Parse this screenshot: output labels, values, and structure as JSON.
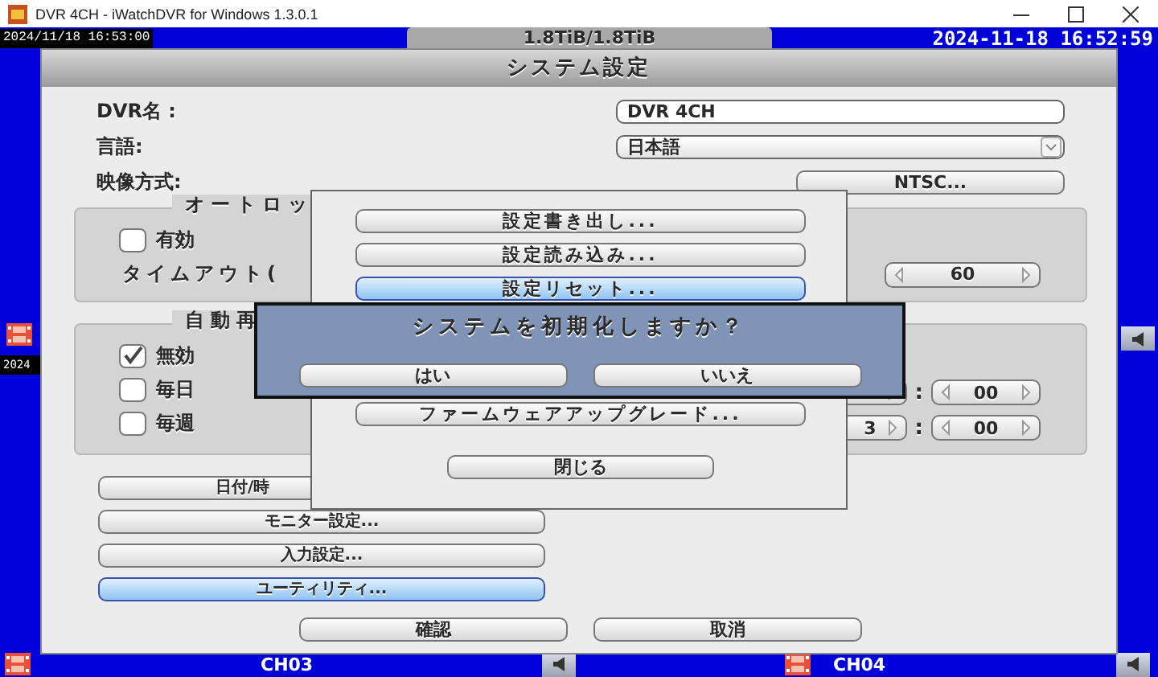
{
  "window": {
    "title": "DVR 4CH - iWatchDVR for Windows 1.3.0.1"
  },
  "video_wall": {
    "top_left_timestamp": "2024/11/18 16:53:00",
    "storage": "1.8TiB/1.8TiB",
    "clock": "2024-11-18 16:52:59",
    "left_timestamp": "2024",
    "channels": [
      {
        "label": "CH03"
      },
      {
        "label": "CH04"
      }
    ]
  },
  "settings_dialog": {
    "title": "システム設定",
    "fields": [
      {
        "kind": "text",
        "label": "DVR名 :",
        "value": "DVR 4CH"
      },
      {
        "kind": "dropdown",
        "label": "言語:",
        "value": "日本語"
      },
      {
        "kind": "button",
        "label": "映像方式:",
        "value": "NTSC..."
      }
    ],
    "auto_lock": {
      "title": "オートロッ",
      "enabled": {
        "label": "有効",
        "checked": false
      },
      "timeout_label": "タイムアウト(",
      "timeout_value": "60"
    },
    "auto_reboot": {
      "title": "自動再",
      "options": [
        {
          "label": "無効",
          "checked": true
        },
        {
          "label": "毎日",
          "checked": false
        },
        {
          "label": "毎週",
          "checked": false
        }
      ],
      "times": [
        {
          "separator": ":",
          "minute": "00"
        },
        {
          "hour": "3",
          "separator": ":",
          "minute": "00"
        }
      ]
    },
    "buttons": [
      {
        "label": "日付/時",
        "selected": false
      },
      {
        "label": "モニター設定...",
        "selected": false
      },
      {
        "label": "入力設定...",
        "selected": false
      },
      {
        "label": "ユーティリティ...",
        "selected": true
      }
    ],
    "confirm": "確認",
    "cancel": "取消"
  },
  "utility_menu": {
    "items": [
      {
        "label": "設定書き出し...",
        "selected": false
      },
      {
        "label": "設定読み込み...",
        "selected": false
      },
      {
        "label": "設定リセット...",
        "selected": true
      },
      {
        "label": "ファームウェアアップグレード...",
        "selected": false
      }
    ],
    "close": "閉じる"
  },
  "confirm_dialog": {
    "message": "システムを初期化しますか？",
    "buttons": [
      "はい",
      "いいえ"
    ]
  }
}
